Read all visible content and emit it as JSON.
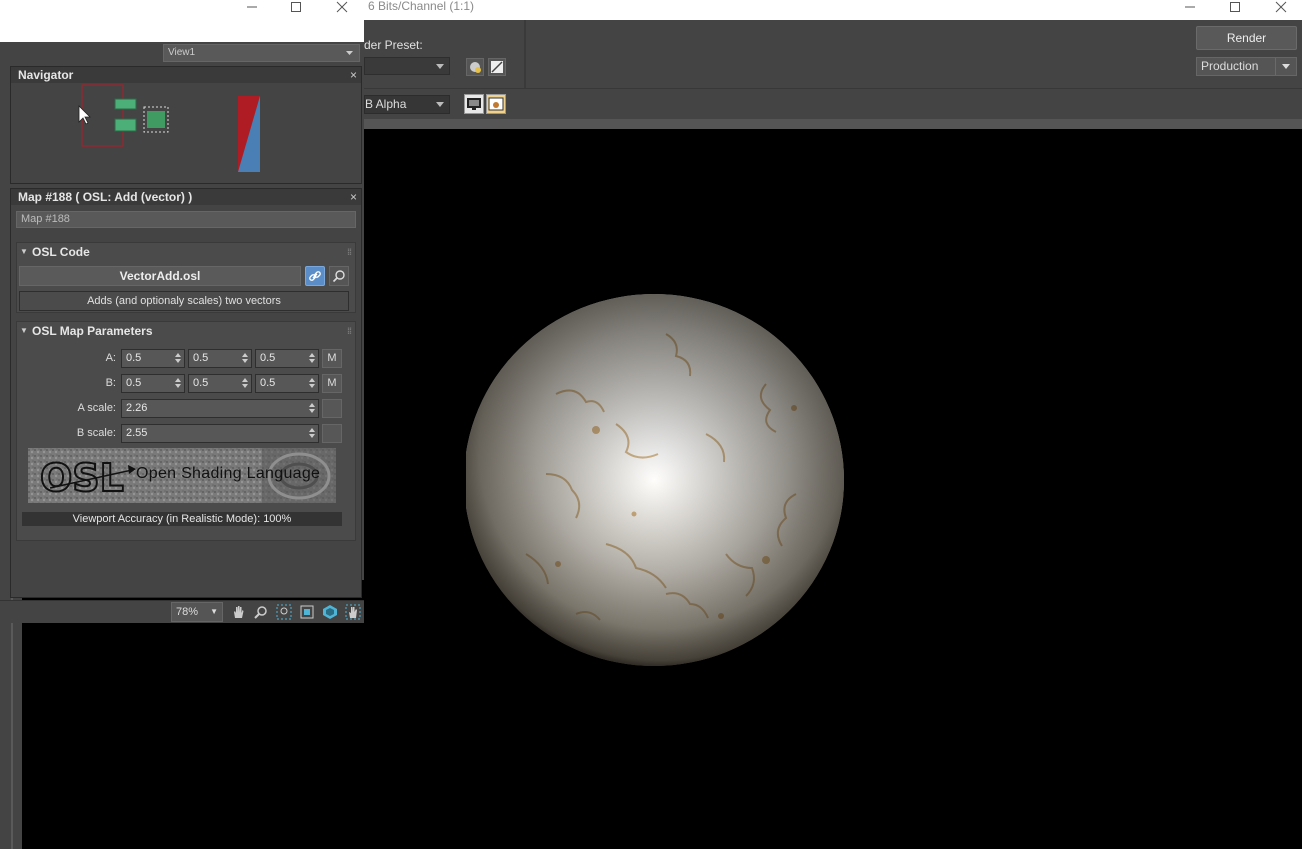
{
  "render_window": {
    "title_fragment": "6 Bits/Channel (1:1)",
    "preset_label": "der Preset:",
    "render_button": "Render",
    "production_select": "Production",
    "channel_select": "B Alpha"
  },
  "slate": {
    "view_tab": "View1",
    "navigator_title": "Navigator",
    "map_panel_title": "Map #188  ( OSL: Add (vector) )",
    "map_name": "Map #188",
    "osl_code": {
      "header": "OSL Code",
      "file": "VectorAdd.osl",
      "description": "Adds (and optionaly scales) two vectors"
    },
    "params": {
      "header": "OSL Map Parameters",
      "a_label": "A:",
      "a_values": [
        "0.5",
        "0.5",
        "0.5"
      ],
      "b_label": "B:",
      "b_values": [
        "0.5",
        "0.5",
        "0.5"
      ],
      "a_scale_label": "A scale:",
      "a_scale": "2.26",
      "b_scale_label": "B scale:",
      "b_scale": "2.55",
      "m_button": "M"
    },
    "osl_logo_text": "Open Shading Language",
    "osl_logo_mark": "OSL",
    "accuracy": "Viewport Accuracy (in Realistic Mode): 100%",
    "zoom": "78%",
    "close_glyph": "×"
  },
  "colors": {
    "panel_bg": "#444444",
    "link_button": "#5b8ec9",
    "node_green": "#4caf78",
    "nav_frame_red": "#b01c24",
    "swatch_blue": "#4a7fb5"
  }
}
